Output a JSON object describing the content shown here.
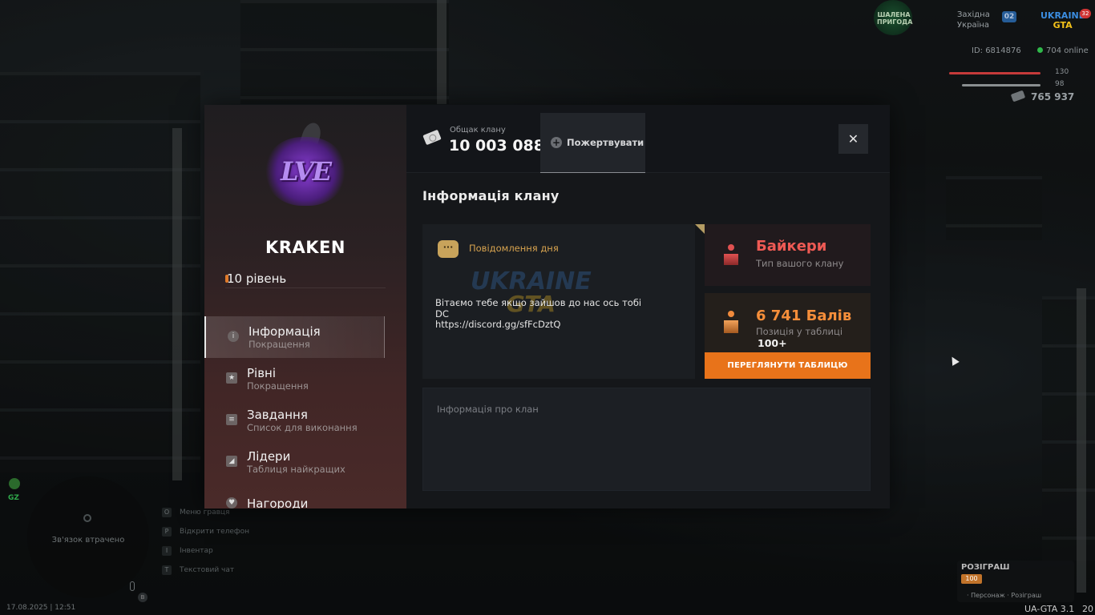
{
  "hud": {
    "server_logo": "ШАЛЕНА ПРИГОДА",
    "region_line1": "Західна",
    "region_line2": "Україна",
    "region_num": "02",
    "ua_logo_top": "UKRAINE",
    "ua_logo_bottom": "GTA",
    "ua_badge": "32",
    "player_id": "ID: 6814876",
    "online": "704 online",
    "health_value": "130",
    "armor_value": "98",
    "money": "765 937",
    "minimap_status": "Зв'язок втрачено",
    "gz_label": "GZ",
    "hotkeys": [
      {
        "key": "O",
        "label": "Меню гравця"
      },
      {
        "key": "P",
        "label": "Відкрити телефон"
      },
      {
        "key": "I",
        "label": "Інвентар"
      },
      {
        "key": "T",
        "label": "Текстовий чат"
      }
    ],
    "mic_key": "B",
    "datetime": "17.08.2025 | 12:51",
    "giveaway_title": "РОЗІГРАШ",
    "giveaway_badge": "100",
    "giveaway_hint": "· Персонаж · Розіграш",
    "version": "UA-GTA 3.1",
    "version_extra": "20"
  },
  "clan": {
    "name": "KRAKEN",
    "logo_text": "LVE",
    "level": "10 рівень",
    "menu": [
      {
        "title": "Інформація",
        "subtitle": "Покращення",
        "icon": "info-icon",
        "active": true
      },
      {
        "title": "Рівні",
        "subtitle": "Покращення",
        "icon": "star-icon",
        "active": false
      },
      {
        "title": "Завдання",
        "subtitle": "Список для виконання",
        "icon": "tasks-icon",
        "active": false
      },
      {
        "title": "Лідери",
        "subtitle": "Таблиця найкращих",
        "icon": "leaders-icon",
        "active": false
      },
      {
        "title": "Нагороди",
        "subtitle": "",
        "icon": "award-icon",
        "active": false
      }
    ],
    "bank_label": "Общак клану",
    "bank_value": "10 003 088",
    "donate_label": "Пожертвувати",
    "close_label": "✕",
    "section_title": "Інформація клану",
    "motd_title": "Повідомлення дня",
    "motd_watermark_top": "UKRAINE",
    "motd_watermark_bottom": "GTA",
    "motd_text": "Вітаємо тебе якщо зайшов до нас ось тобі\nDC\nhttps://discord.gg/sfFcDztQ",
    "type_name": "Байкери",
    "type_sub": "Тип вашого клану",
    "score_value": "6 741 Балів",
    "score_sub": "Позиція у таблиці",
    "score_rank": "100+",
    "table_button": "ПЕРЕГЛЯНУТИ ТАБЛИЦЮ",
    "info_label": "Інформація про клан"
  },
  "colors": {
    "accent_orange": "#e8731a",
    "type_red": "#ef5a54",
    "motd_gold": "#d7a34f"
  }
}
